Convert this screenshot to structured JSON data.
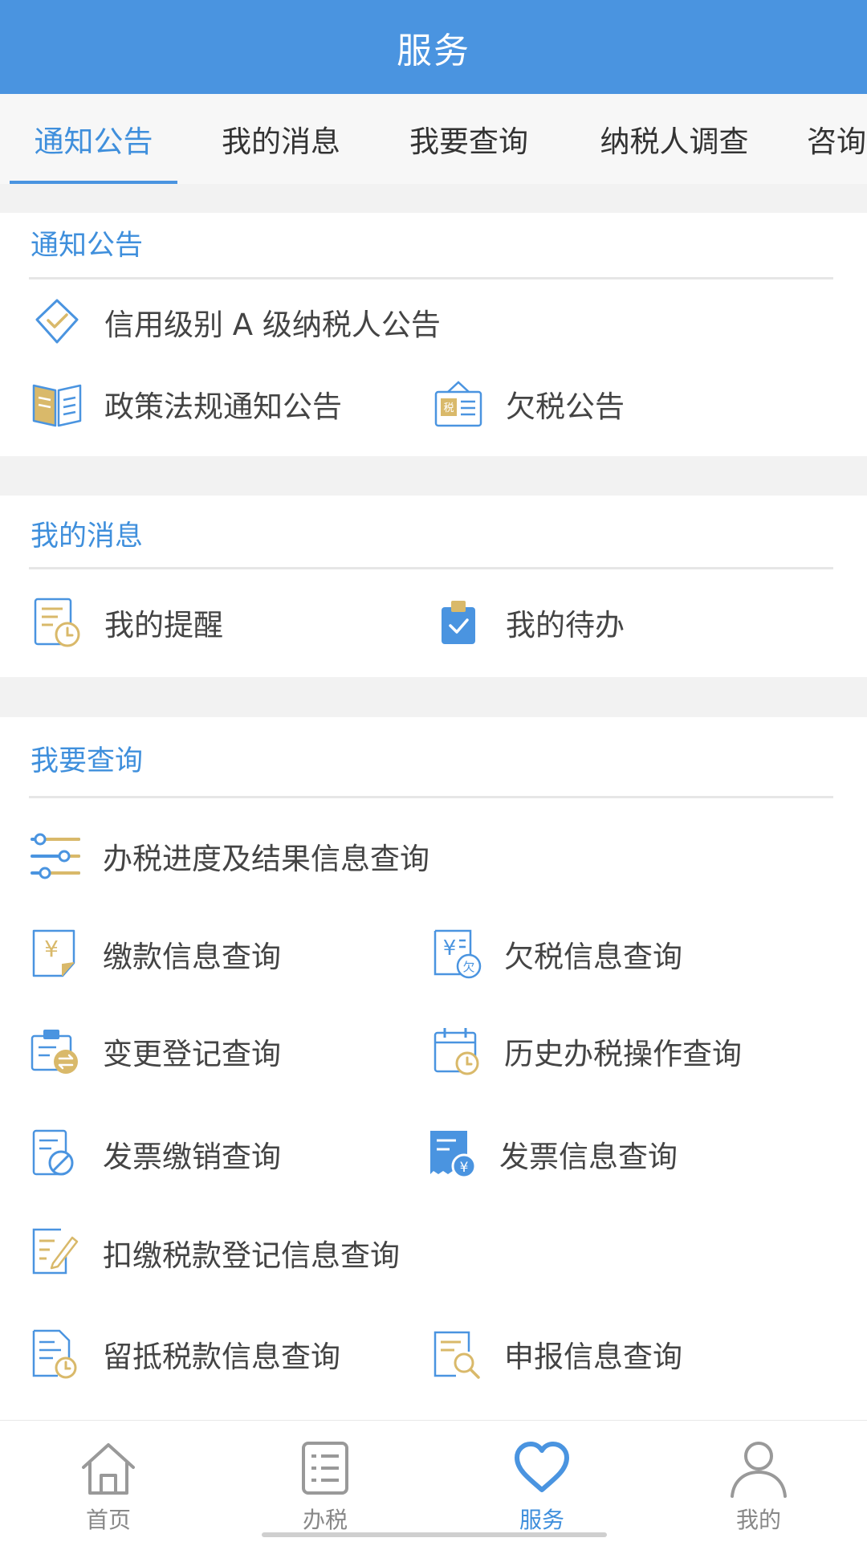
{
  "header": {
    "title": "服务"
  },
  "tabs": [
    {
      "label": "通知公告",
      "active": true
    },
    {
      "label": "我的消息"
    },
    {
      "label": "我要查询"
    },
    {
      "label": "纳税人调查"
    },
    {
      "label": "咨询"
    }
  ],
  "sections": {
    "notice": {
      "title": "通知公告",
      "items": [
        {
          "label": "信用级别 A 级纳税人公告",
          "icon": "shield-check-icon"
        },
        {
          "label": "政策法规通知公告",
          "icon": "book-icon"
        },
        {
          "label": "欠税公告",
          "icon": "tax-sign-icon"
        }
      ]
    },
    "messages": {
      "title": "我的消息",
      "items": [
        {
          "label": "我的提醒",
          "icon": "reminder-clock-icon"
        },
        {
          "label": "我的待办",
          "icon": "todo-clipboard-icon"
        }
      ]
    },
    "query": {
      "title": "我要查询",
      "items": [
        {
          "label": "办税进度及结果信息查询",
          "icon": "progress-sliders-icon"
        },
        {
          "label": "缴款信息查询",
          "icon": "payment-yen-icon"
        },
        {
          "label": "欠税信息查询",
          "icon": "arrears-yen-icon"
        },
        {
          "label": "变更登记查询",
          "icon": "change-register-icon"
        },
        {
          "label": "历史办税操作查询",
          "icon": "history-calendar-icon"
        },
        {
          "label": "发票缴销查询",
          "icon": "invoice-cancel-icon"
        },
        {
          "label": "发票信息查询",
          "icon": "invoice-info-icon"
        },
        {
          "label": "扣缴税款登记信息查询",
          "icon": "withholding-edit-icon"
        },
        {
          "label": "留抵税款信息查询",
          "icon": "retained-tax-icon"
        },
        {
          "label": "申报信息查询",
          "icon": "declaration-search-icon"
        }
      ]
    }
  },
  "bottom_nav": [
    {
      "label": "首页",
      "icon": "home-icon"
    },
    {
      "label": "办税",
      "icon": "list-icon"
    },
    {
      "label": "服务",
      "icon": "heart-icon",
      "active": true
    },
    {
      "label": "我的",
      "icon": "user-icon"
    }
  ],
  "colors": {
    "primary": "#4a94e0",
    "accent_gold": "#d9b96a",
    "text": "#444444",
    "background": "#f2f2f2"
  }
}
